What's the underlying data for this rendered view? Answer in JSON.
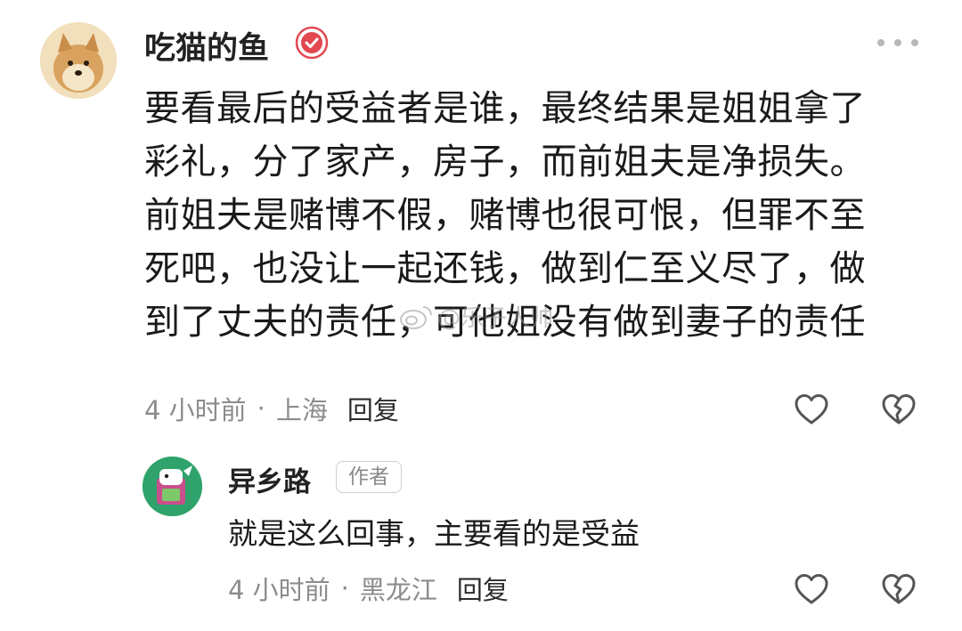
{
  "comment": {
    "username": "吃猫的鱼",
    "verified_icon": "verified-badge-icon",
    "lines": [
      "要看最后的受益者是谁，最终结果是姐姐拿了",
      "彩礼，分了家产，房子，而前姐夫是净损失。",
      "前姐夫是赌博不假，赌博也很可恨，但罪不至",
      "死吧，也没让一起还钱，做到仁至义尽了，做",
      "到了丈夫的责任，可他姐没有做到妻子的责任"
    ],
    "time": "4 小时前",
    "location": "上海",
    "reply_label": "回复",
    "separator": "·"
  },
  "reply": {
    "username": "异乡路",
    "badge": "作者",
    "text": "就是这么回事，主要看的是受益",
    "time": "4 小时前",
    "location": "黑龙江",
    "reply_label": "回复",
    "separator": "·"
  },
  "watermark": "@乐子人帅",
  "colors": {
    "verified": "#e2484f",
    "meta_text": "#8c8c8c",
    "icon_stroke": "#555555"
  }
}
